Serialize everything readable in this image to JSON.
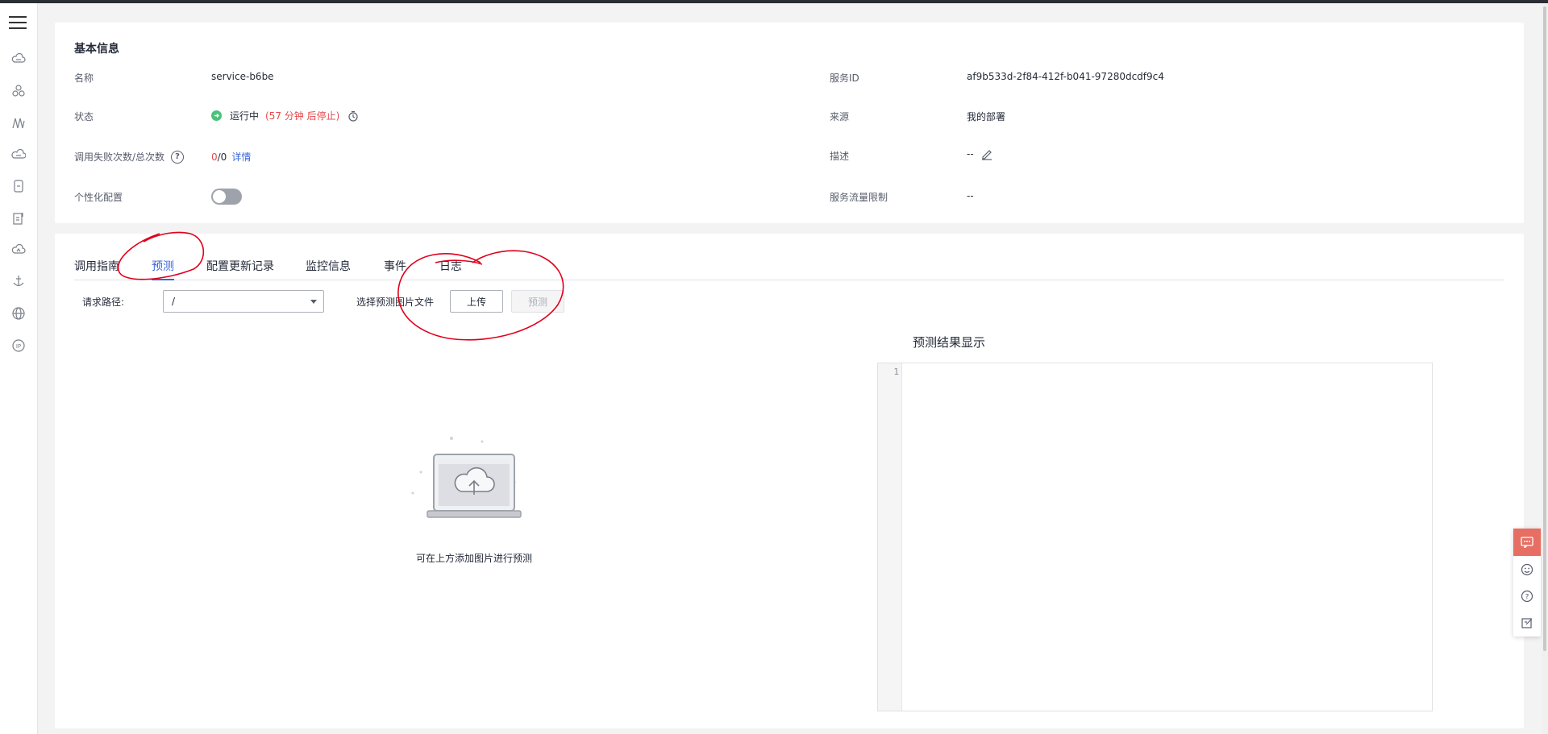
{
  "basic_info": {
    "title": "基本信息",
    "name_label": "名称",
    "name_value": "service-b6be",
    "service_id_label": "服务ID",
    "service_id_value": "af9b533d-2f84-412f-b041-97280dcdf9c4",
    "status_label": "状态",
    "status_value": "运行中",
    "status_remaining": "(57 分钟 后停止)",
    "source_label": "来源",
    "source_value": "我的部署",
    "calls_label": "调用失败次数/总次数",
    "calls_failed": "0",
    "calls_total": "/0",
    "calls_detail_link": "详情",
    "desc_label": "描述",
    "desc_value": "--",
    "personal_config_label": "个性化配置",
    "traffic_limit_label": "服务流量限制",
    "traffic_limit_value": "--"
  },
  "tabs": [
    {
      "label": "调用指南"
    },
    {
      "label": "预测",
      "active": true
    },
    {
      "label": "配置更新记录"
    },
    {
      "label": "监控信息"
    },
    {
      "label": "事件"
    },
    {
      "label": "日志"
    }
  ],
  "predict": {
    "path_label": "请求路径:",
    "path_value": "/",
    "choose_file_label": "选择预测图片文件",
    "upload_button": "上传",
    "predict_button": "预测",
    "empty_hint": "可在上方添加图片进行预测",
    "result_title": "预测结果显示",
    "editor_line": "1"
  },
  "colors": {
    "accent": "#3865d8",
    "error": "#e5484d",
    "running": "#4ac27a",
    "annotation": "#e0001b",
    "float_hot": "#e76e63"
  },
  "icons": {
    "rail": [
      "menu-icon",
      "cloud-icon",
      "cluster-icon",
      "model-icon",
      "cloud-storage-icon",
      "device-icon",
      "document-icon",
      "cloud-upload-icon",
      "anchor-icon",
      "globe-icon",
      "ip-icon"
    ],
    "float": [
      "feedback-icon",
      "smile-icon",
      "help-icon",
      "note-icon"
    ]
  }
}
